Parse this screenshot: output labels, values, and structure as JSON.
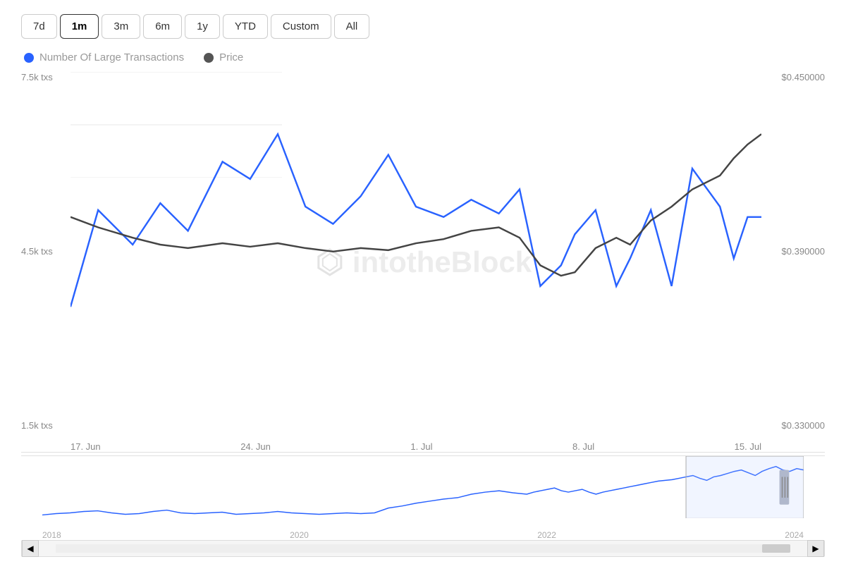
{
  "timeButtons": [
    {
      "label": "7d",
      "active": false
    },
    {
      "label": "1m",
      "active": true
    },
    {
      "label": "3m",
      "active": false
    },
    {
      "label": "6m",
      "active": false
    },
    {
      "label": "1y",
      "active": false
    },
    {
      "label": "YTD",
      "active": false
    },
    {
      "label": "Custom",
      "active": false
    },
    {
      "label": "All",
      "active": false
    }
  ],
  "legend": [
    {
      "label": "Number Of Large Transactions",
      "color": "#2962ff",
      "type": "dot"
    },
    {
      "label": "Price",
      "color": "#555",
      "type": "dot"
    }
  ],
  "yAxisLeft": [
    "7.5k txs",
    "4.5k txs",
    "1.5k txs"
  ],
  "yAxisRight": [
    "$0.450000",
    "$0.390000",
    "$0.330000"
  ],
  "xAxisLabels": [
    "17. Jun",
    "24. Jun",
    "1. Jul",
    "8. Jul",
    "15. Jul"
  ],
  "overviewXLabels": [
    "2018",
    "2020",
    "2022",
    "2024"
  ],
  "watermark": "intotheBlock",
  "scrollLeft": "◀",
  "scrollRight": "▶"
}
